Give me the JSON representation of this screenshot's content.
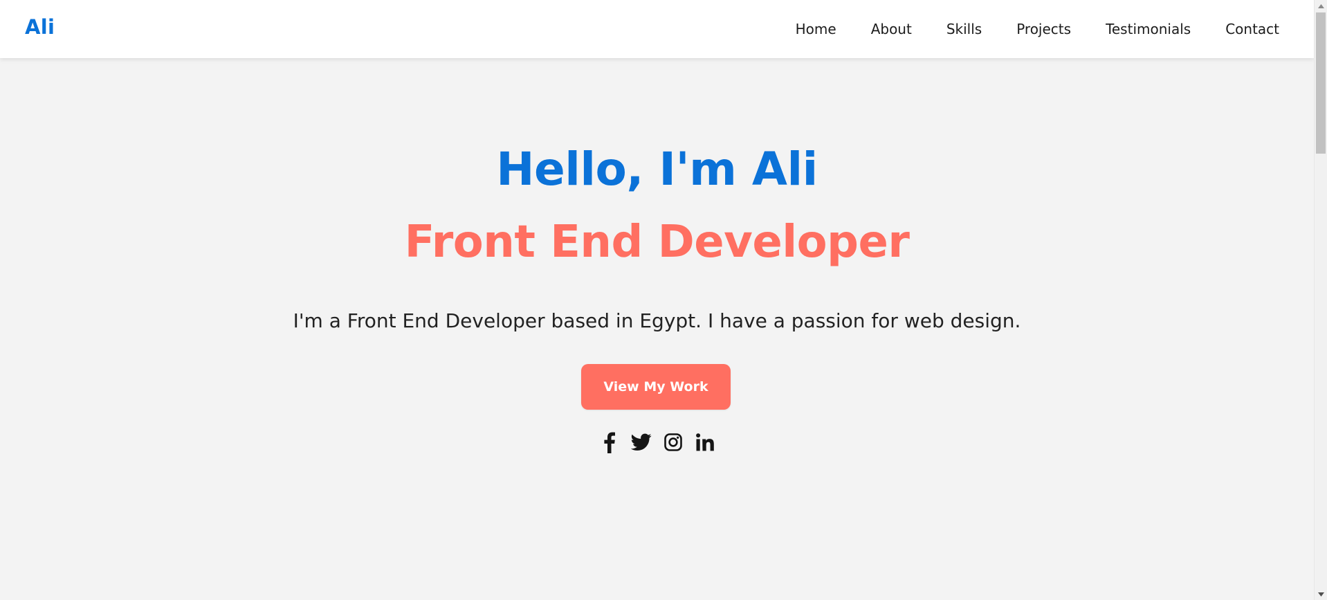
{
  "nav": {
    "brand": "Ali",
    "links": [
      "Home",
      "About",
      "Skills",
      "Projects",
      "Testimonials",
      "Contact"
    ]
  },
  "hero": {
    "title": "Hello, I'm Ali",
    "subtitle": "Front End Developer",
    "description": "I'm a Front End Developer based in Egypt. I have a passion for web design.",
    "cta_label": "View My Work"
  },
  "socials": [
    {
      "icon": "facebook-icon"
    },
    {
      "icon": "twitter-icon"
    },
    {
      "icon": "instagram-icon"
    },
    {
      "icon": "linkedin-icon"
    }
  ],
  "colors": {
    "brand_blue": "#0b72d8",
    "accent_coral": "#ff6f61",
    "background": "#f3f3f3",
    "navbar_bg": "#ffffff",
    "text_dark": "#222222"
  }
}
